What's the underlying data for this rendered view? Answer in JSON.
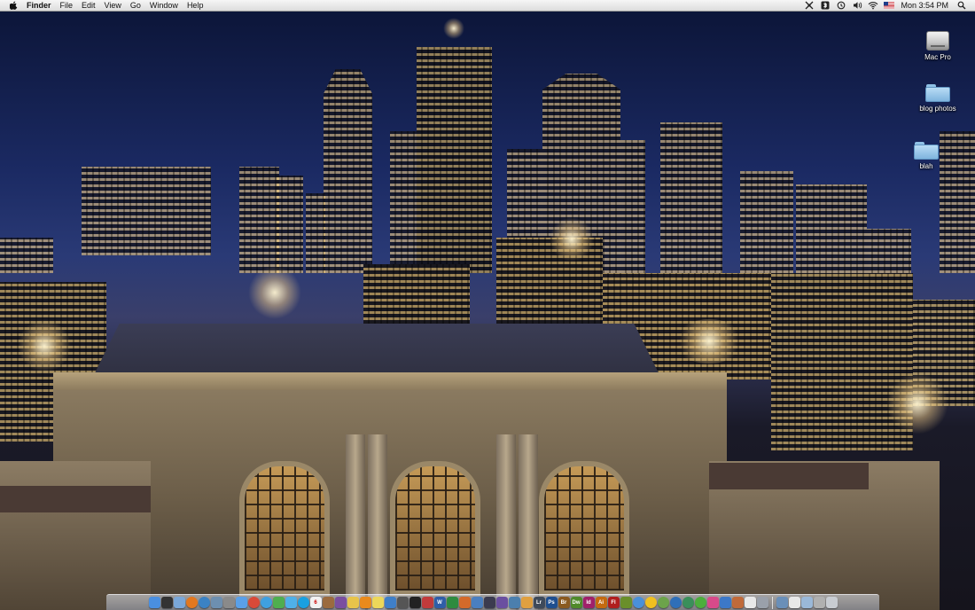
{
  "menubar": {
    "app_name": "Finder",
    "menus": [
      "File",
      "Edit",
      "View",
      "Go",
      "Window",
      "Help"
    ],
    "clock": "Mon 3:54 PM"
  },
  "desktop_icons": [
    {
      "label": "Mac Pro",
      "kind": "hard-drive-icon"
    },
    {
      "label": "blog photos",
      "kind": "folder-icon"
    },
    {
      "label": "blah",
      "kind": "folder-icon"
    }
  ],
  "dock": {
    "apps": [
      {
        "name": "finder-icon",
        "color": "#4a8fe0",
        "text": ""
      },
      {
        "name": "dashboard-icon",
        "color": "#333333",
        "text": ""
      },
      {
        "name": "mail-icon",
        "color": "#7aa7d8",
        "text": ""
      },
      {
        "name": "firefox-icon",
        "color": "#e3781f",
        "text": ""
      },
      {
        "name": "safari-icon",
        "color": "#3b82c4",
        "text": ""
      },
      {
        "name": "preview-icon",
        "color": "#6d8fb0",
        "text": ""
      },
      {
        "name": "system-preferences-icon",
        "color": "#8a8a8a",
        "text": ""
      },
      {
        "name": "itunes-icon",
        "color": "#5aa0e8",
        "text": ""
      },
      {
        "name": "chrome-icon",
        "color": "#d94a38",
        "text": ""
      },
      {
        "name": "ichat-icon",
        "color": "#3fa0e0",
        "text": ""
      },
      {
        "name": "adium-icon",
        "color": "#4fae4f",
        "text": ""
      },
      {
        "name": "twitter-icon",
        "color": "#4fb0e8",
        "text": ""
      },
      {
        "name": "skype-icon",
        "color": "#1aa0e0",
        "text": ""
      },
      {
        "name": "calendar-icon",
        "color": "#f2f2f2",
        "text": "6"
      },
      {
        "name": "address-book-icon",
        "color": "#9b6b3f",
        "text": ""
      },
      {
        "name": "textmate-icon",
        "color": "#7a4fa0",
        "text": ""
      },
      {
        "name": "notes-icon",
        "color": "#e8c44a",
        "text": ""
      },
      {
        "name": "vlc-icon",
        "color": "#e98a1c",
        "text": ""
      },
      {
        "name": "stickies-icon",
        "color": "#ecd85a",
        "text": ""
      },
      {
        "name": "network-icon",
        "color": "#3f7fc8",
        "text": ""
      },
      {
        "name": "activity-monitor-icon",
        "color": "#555555",
        "text": ""
      },
      {
        "name": "terminal-icon",
        "color": "#222222",
        "text": ""
      },
      {
        "name": "photo-booth-icon",
        "color": "#c23b3b",
        "text": ""
      },
      {
        "name": "word-icon",
        "color": "#2f5ea8",
        "text": "W"
      },
      {
        "name": "excel-icon",
        "color": "#2e8b3f",
        "text": ""
      },
      {
        "name": "powerpoint-icon",
        "color": "#d46a2a",
        "text": ""
      },
      {
        "name": "entourage-icon",
        "color": "#4a7fc0",
        "text": ""
      },
      {
        "name": "camera-icon",
        "color": "#3b3b4f",
        "text": ""
      },
      {
        "name": "imovie-icon",
        "color": "#6a4fa0",
        "text": ""
      },
      {
        "name": "iphoto-icon",
        "color": "#4b7fae",
        "text": ""
      },
      {
        "name": "garageband-icon",
        "color": "#e0a040",
        "text": ""
      },
      {
        "name": "lightroom-icon",
        "color": "#3e4a5a",
        "text": "Lr"
      },
      {
        "name": "photoshop-icon",
        "color": "#1f4f8f",
        "text": "Ps"
      },
      {
        "name": "bridge-icon",
        "color": "#8a5a20",
        "text": "Br"
      },
      {
        "name": "dreamweaver-icon",
        "color": "#4f8a2a",
        "text": "Dw"
      },
      {
        "name": "indesign-icon",
        "color": "#a0206a",
        "text": "Id"
      },
      {
        "name": "illustrator-icon",
        "color": "#c46a10",
        "text": "Ai"
      },
      {
        "name": "flash-icon",
        "color": "#b01e1e",
        "text": "Fl"
      },
      {
        "name": "fireworks-icon",
        "color": "#6a8f2a",
        "text": ""
      },
      {
        "name": "quicktime-icon",
        "color": "#4a90d9",
        "text": ""
      },
      {
        "name": "smiley-icon",
        "color": "#f0c020",
        "text": ""
      },
      {
        "name": "spotify-icon",
        "color": "#6ca34a",
        "text": ""
      },
      {
        "name": "globe-icon",
        "color": "#2f6fb8",
        "text": ""
      },
      {
        "name": "time-machine-icon",
        "color": "#3a8f5a",
        "text": ""
      },
      {
        "name": "utorrent-icon",
        "color": "#4cae3c",
        "text": ""
      },
      {
        "name": "picasa-icon",
        "color": "#d84a8a",
        "text": ""
      },
      {
        "name": "app-store-icon",
        "color": "#3c78c8",
        "text": ""
      },
      {
        "name": "ftp-icon",
        "color": "#c06a3a",
        "text": ""
      },
      {
        "name": "textedit-icon",
        "color": "#e8e8e8",
        "text": ""
      },
      {
        "name": "arrow-icon",
        "color": "#9aa0aa",
        "text": ""
      }
    ],
    "stack_items": [
      {
        "name": "applications-stack-icon",
        "color": "#6a8fb8",
        "text": ""
      },
      {
        "name": "documents-stack-icon",
        "color": "#e8e8e8",
        "text": ""
      },
      {
        "name": "downloads-stack-icon",
        "color": "#9ab8d8",
        "text": ""
      },
      {
        "name": "pictures-stack-icon",
        "color": "#b0b0b0",
        "text": ""
      },
      {
        "name": "trash-icon",
        "color": "#c8ccd2",
        "text": ""
      }
    ]
  }
}
